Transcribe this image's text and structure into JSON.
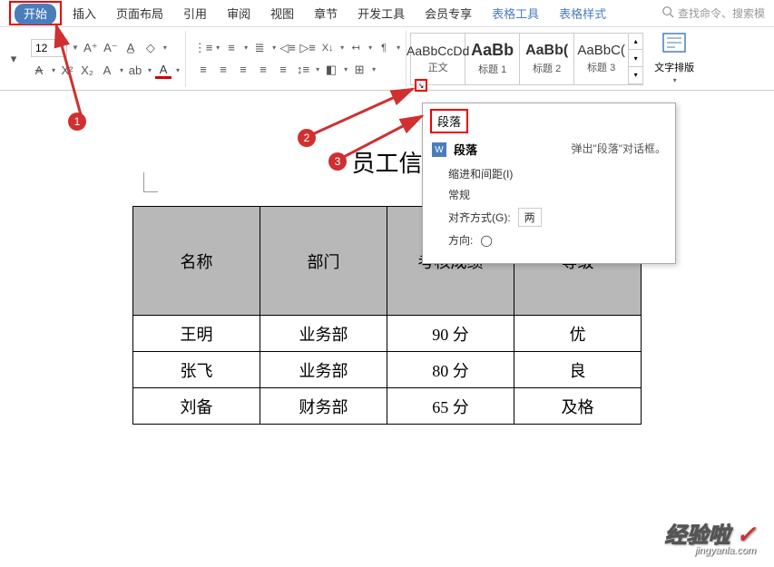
{
  "tabs": {
    "start": "开始",
    "insert": "插入",
    "layout": "页面布局",
    "reference": "引用",
    "review": "审阅",
    "view": "视图",
    "chapter": "章节",
    "dev": "开发工具",
    "member": "会员专享",
    "table_tools": "表格工具",
    "table_style": "表格样式"
  },
  "search": {
    "placeholder": "查找命令、搜索模"
  },
  "font": {
    "size": "12"
  },
  "styles": {
    "s1_preview": "AaBbCcDd",
    "s1_name": "正文",
    "s2_preview": "AaBb",
    "s2_name": "标题 1",
    "s3_preview": "AaBb(",
    "s3_name": "标题 2",
    "s4_preview": "AaBbC(",
    "s4_name": "标题 3"
  },
  "text_layout": "文字排版",
  "tooltip": {
    "title": "段落",
    "heading": "段落",
    "desc": "弹出\"段落\"对话框。",
    "indent": "缩进和间距(I)",
    "general": "常规",
    "align_label": "对齐方式(G):",
    "align_value": "两",
    "direction_label": "方向:"
  },
  "doc": {
    "title": "员工信",
    "headers": [
      "名称",
      "部门",
      "考核成绩",
      "等级"
    ],
    "rows": [
      [
        "王明",
        "业务部",
        "90 分",
        "优"
      ],
      [
        "张飞",
        "业务部",
        "80 分",
        "良"
      ],
      [
        "刘备",
        "财务部",
        "65 分",
        "及格"
      ]
    ]
  },
  "badges": {
    "b1": "1",
    "b2": "2",
    "b3": "3"
  },
  "watermark": {
    "main": "经验啦",
    "sub": "jingyanla.com"
  }
}
